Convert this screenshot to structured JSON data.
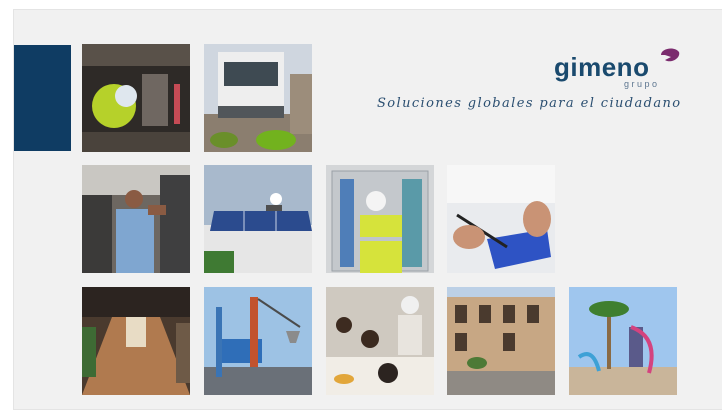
{
  "brand": {
    "name": "gimeno",
    "sub": "grupo",
    "tagline": "Soluciones globales para el ciudadano",
    "colors": {
      "primary": "#0f3c63",
      "wordmark": "#1a4a6e",
      "mark": "#7b2c6e"
    }
  },
  "photos": [
    "sewer-worker-photo",
    "street-sweeper-photo",
    "technician-pipes-photo",
    "solar-panels-photo",
    "electrical-panel-photo",
    "circuit-board-photo",
    "office-corridor-photo",
    "port-crane-photo",
    "school-canteen-photo",
    "historic-facade-photo",
    "water-park-photo"
  ]
}
